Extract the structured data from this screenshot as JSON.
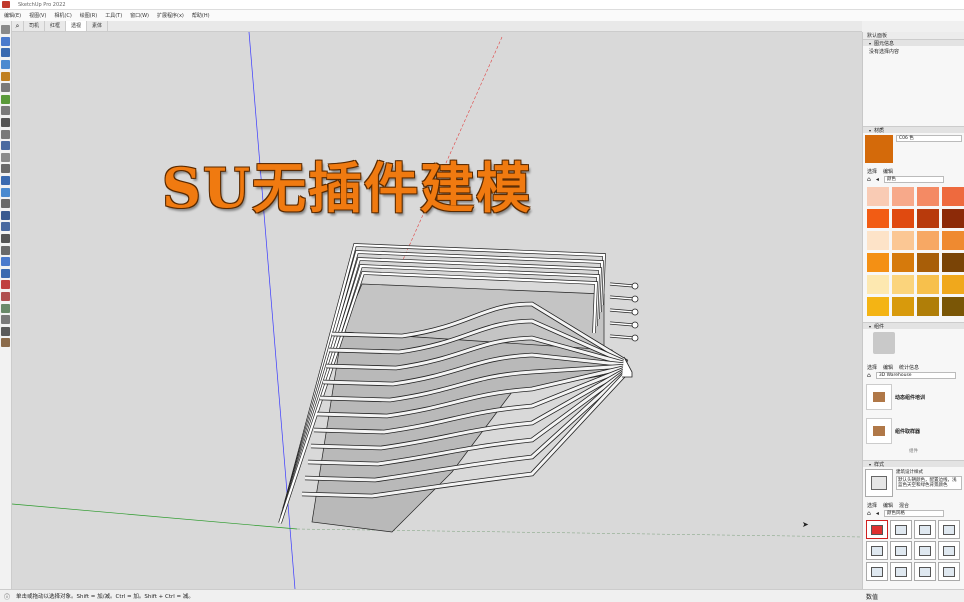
{
  "window": {
    "title": "SketchUp Pro 2022"
  },
  "menu": [
    "编辑(E)",
    "视图(V)",
    "相机(C)",
    "绘图(R)",
    "工具(T)",
    "窗口(W)",
    "扩展程序(x)",
    "帮助(H)"
  ],
  "scene_tabs": {
    "search_icon": "search-icon",
    "tabs": [
      "司机",
      "红框",
      "透视",
      "素体"
    ],
    "active_index": 2
  },
  "overlay_title": "SU无插件建模",
  "status": {
    "text": "单击或拖动以选择对象。Shift = 加/减。Ctrl = 加。Shift + Ctrl = 减。",
    "measure_label": "数值"
  },
  "tray": {
    "header": "默认面板",
    "entity_info": {
      "title": "图元信息",
      "content": "没有选择内容"
    },
    "materials": {
      "title": "材质",
      "current_name": "C06 色",
      "current_color": "#d46a0a",
      "tabs": [
        "选择",
        "编辑"
      ],
      "library": "颜色",
      "swatches": [
        "#f9cbb4",
        "#f7a98a",
        "#f48a64",
        "#ee6a3e",
        "#f25c14",
        "#e04a10",
        "#b83a0c",
        "#8c2a08",
        "#fde3c8",
        "#fbc794",
        "#f7a864",
        "#ef8a30",
        "#f49014",
        "#d67a0c",
        "#a85e08",
        "#7a4406",
        "#fde8b0",
        "#fbd47c",
        "#f7c04c",
        "#f0a81c",
        "#f4b414",
        "#d89a0c",
        "#b07e08",
        "#7a5606"
      ]
    },
    "components": {
      "title": "组件",
      "tabs": [
        "选择",
        "编辑",
        "统计信息"
      ],
      "search_placeholder": "3D Warehouse",
      "items": [
        "动态组件培训",
        "组件取样器"
      ],
      "footer": "组件"
    },
    "styles": {
      "title": "样式",
      "current_name": "建筑设计样式",
      "description": "默认头朝颜色，配置边线，浅蓝色天空和绿色背景颜色",
      "tabs": [
        "选择",
        "编辑",
        "混合"
      ],
      "library": "颜色风格"
    }
  }
}
